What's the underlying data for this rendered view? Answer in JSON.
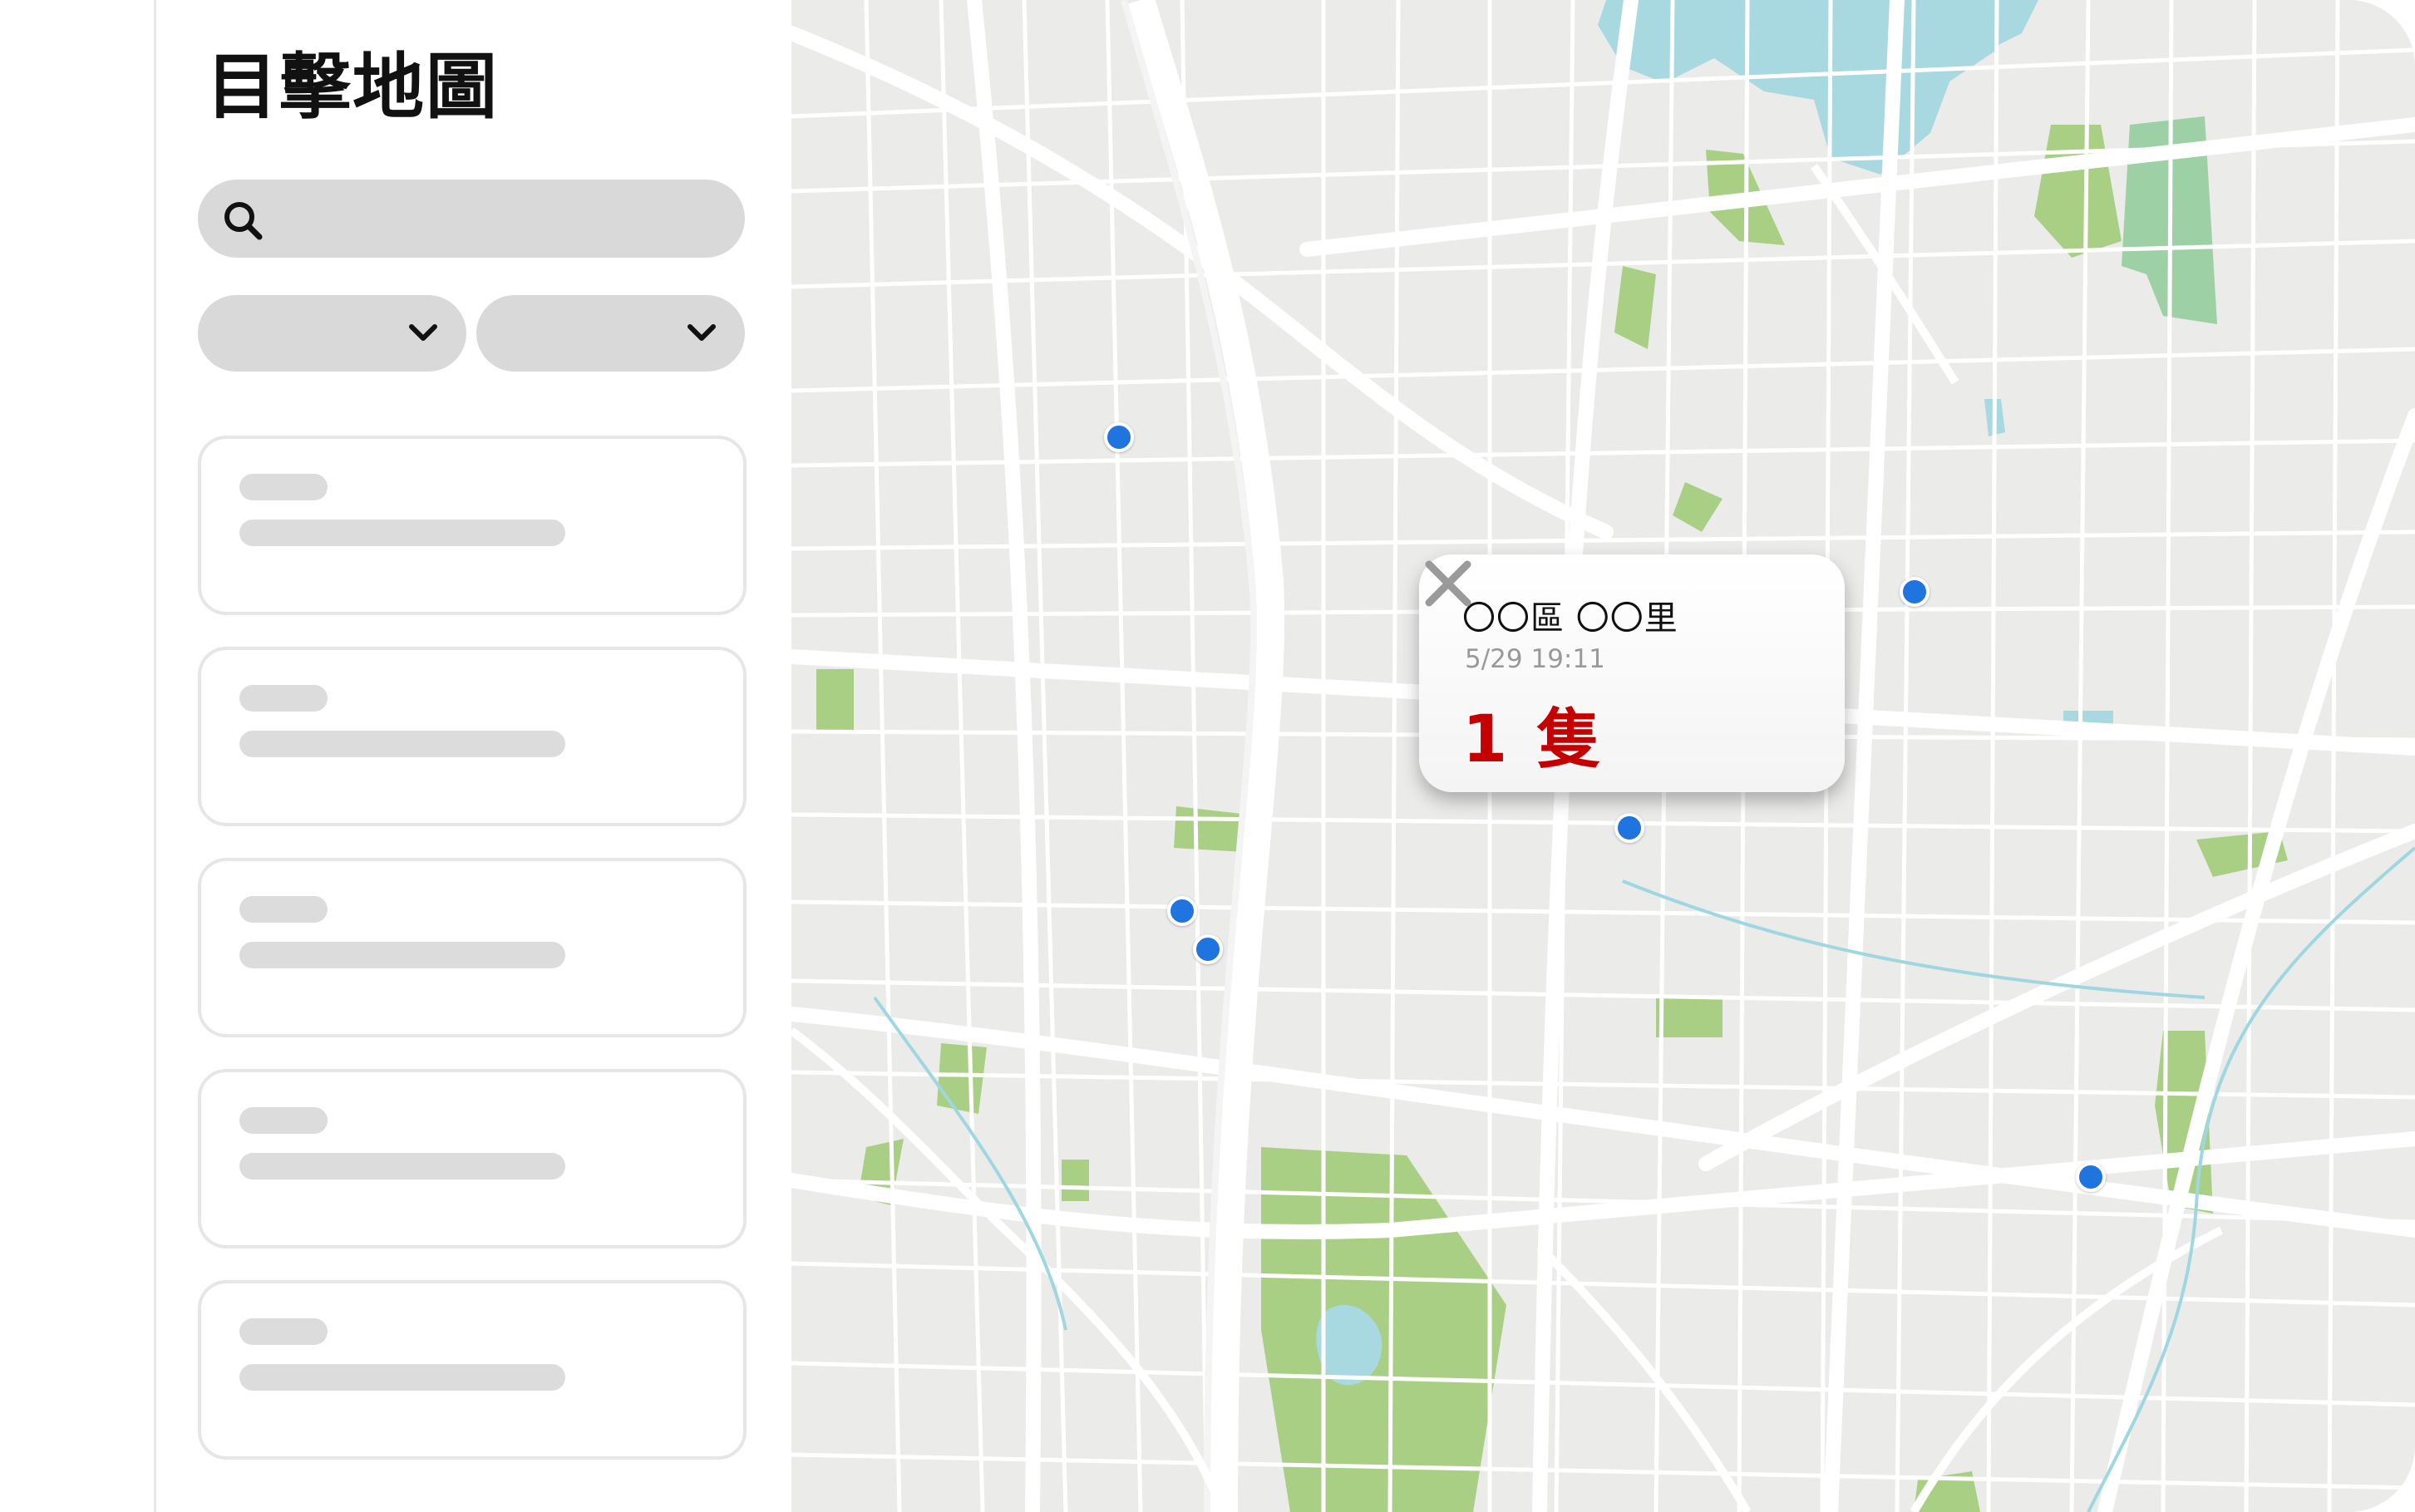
{
  "sidebar": {
    "title": "目擊地圖",
    "search": {
      "value": "",
      "placeholder": "",
      "icon": "search-icon"
    },
    "filters": [
      {
        "value": "",
        "icon": "chevron-down-icon"
      },
      {
        "value": "",
        "icon": "chevron-down-icon"
      }
    ],
    "list_count": 5
  },
  "map": {
    "markers": [
      {
        "id": "marker-1"
      },
      {
        "id": "marker-2"
      },
      {
        "id": "marker-3"
      },
      {
        "id": "marker-4"
      },
      {
        "id": "marker-5"
      },
      {
        "id": "marker-6"
      }
    ],
    "popup": {
      "location": "〇〇區 〇〇里",
      "time": "5/29 19:11",
      "count": "1 隻",
      "close_icon": "close-icon"
    }
  },
  "colors": {
    "marker": "#1f74e0",
    "count": "#c40000",
    "park": "#a9cf84",
    "water": "#a8d8e0",
    "road": "#ffffff",
    "land": "#ebebea",
    "skeleton": "#dcdcdc"
  }
}
